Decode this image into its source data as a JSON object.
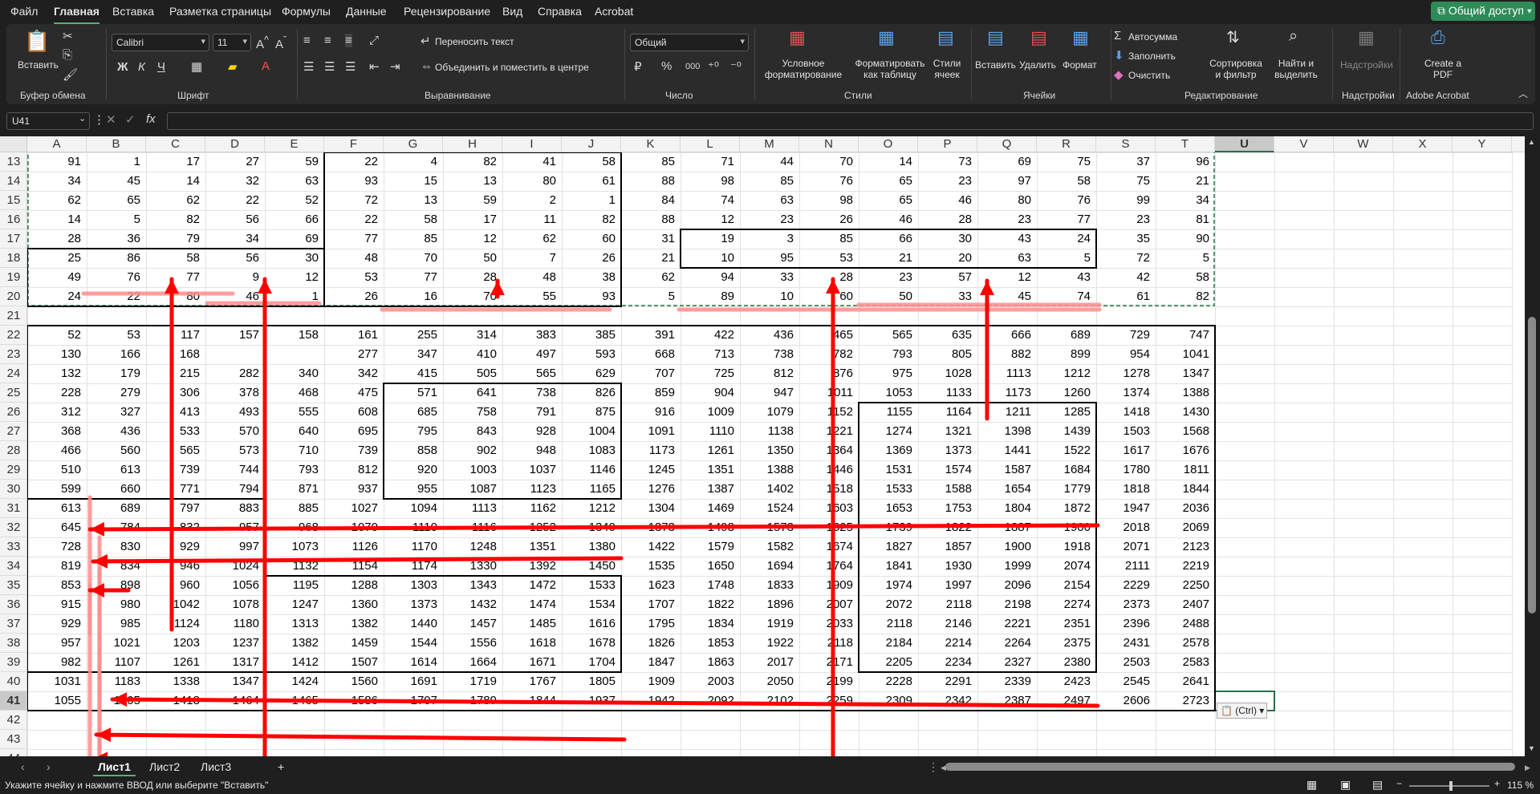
{
  "menu": {
    "items": [
      "Файл",
      "Главная",
      "Вставка",
      "Разметка страницы",
      "Формулы",
      "Данные",
      "Рецензирование",
      "Вид",
      "Справка",
      "Acrobat"
    ],
    "active": "Главная",
    "share": "Общий доступ"
  },
  "ribbon": {
    "clipboard": {
      "paste": "Вставить",
      "group": "Буфер обмена"
    },
    "font": {
      "name": "Calibri",
      "size": "11",
      "group": "Шрифт",
      "bold": "Ж",
      "italic": "К",
      "underline": "Ч"
    },
    "alignment": {
      "wrap": "Переносить текст",
      "merge": "Объединить и поместить в центре",
      "group": "Выравнивание"
    },
    "number": {
      "format": "Общий",
      "percent": "%",
      "thousands": "000",
      "group": "Число"
    },
    "styles": {
      "conditional": "Условное форматирование",
      "as_table": "Форматировать как таблицу",
      "cell_styles": "Стили ячеек",
      "group": "Стили"
    },
    "cells": {
      "insert": "Вставить",
      "delete": "Удалить",
      "format": "Формат",
      "group": "Ячейки"
    },
    "editing": {
      "autosum": "Автосумма",
      "fill": "Заполнить",
      "clear": "Очистить",
      "sort": "Сортировка и фильтр",
      "find": "Найти и выделить",
      "group": "Редактирование"
    },
    "addins": {
      "label": "Надстройки",
      "group": "Надстройки"
    },
    "acrobat": {
      "create": "Create a PDF",
      "group": "Adobe Acrobat"
    }
  },
  "formula_bar": {
    "name_box": "U41",
    "fx": "fx",
    "content": ""
  },
  "columns": [
    "A",
    "B",
    "C",
    "D",
    "E",
    "F",
    "G",
    "H",
    "I",
    "J",
    "K",
    "L",
    "M",
    "N",
    "O",
    "P",
    "Q",
    "R",
    "S",
    "T",
    "U",
    "V",
    "W",
    "X",
    "Y"
  ],
  "selected_column": "U",
  "rows": [
    13,
    14,
    15,
    16,
    17,
    18,
    19,
    20,
    21,
    22,
    23,
    24,
    25,
    26,
    27,
    28,
    29,
    30,
    31,
    32,
    33,
    34,
    35,
    36,
    37,
    38,
    39,
    40,
    41,
    42,
    43,
    44
  ],
  "selected_row": 41,
  "data": [
    [
      "91",
      "1",
      "17",
      "27",
      "59",
      "22",
      "4",
      "82",
      "41",
      "58",
      "85",
      "71",
      "44",
      "70",
      "14",
      "73",
      "69",
      "75",
      "37",
      "96"
    ],
    [
      "34",
      "45",
      "14",
      "32",
      "63",
      "93",
      "15",
      "13",
      "80",
      "61",
      "88",
      "98",
      "85",
      "76",
      "65",
      "23",
      "97",
      "58",
      "75",
      "21"
    ],
    [
      "62",
      "65",
      "62",
      "22",
      "52",
      "72",
      "13",
      "59",
      "2",
      "1",
      "84",
      "74",
      "63",
      "98",
      "65",
      "46",
      "80",
      "76",
      "99",
      "34"
    ],
    [
      "14",
      "5",
      "82",
      "56",
      "66",
      "22",
      "58",
      "17",
      "11",
      "82",
      "88",
      "12",
      "23",
      "26",
      "46",
      "28",
      "23",
      "77",
      "23",
      "81"
    ],
    [
      "28",
      "36",
      "79",
      "34",
      "69",
      "77",
      "85",
      "12",
      "62",
      "60",
      "31",
      "19",
      "3",
      "85",
      "66",
      "30",
      "43",
      "24",
      "35",
      "90"
    ],
    [
      "25",
      "86",
      "58",
      "56",
      "30",
      "48",
      "70",
      "50",
      "7",
      "26",
      "21",
      "10",
      "95",
      "53",
      "21",
      "20",
      "63",
      "5",
      "72",
      "5"
    ],
    [
      "49",
      "76",
      "77",
      "9",
      "12",
      "53",
      "77",
      "28",
      "48",
      "38",
      "62",
      "94",
      "33",
      "28",
      "23",
      "57",
      "12",
      "43",
      "42",
      "58"
    ],
    [
      "24",
      "22",
      "80",
      "46",
      "1",
      "26",
      "16",
      "70",
      "55",
      "93",
      "5",
      "89",
      "10",
      "60",
      "50",
      "33",
      "45",
      "74",
      "61",
      "82"
    ],
    [],
    [
      "52",
      "53",
      "117",
      "157",
      "158",
      "161",
      "255",
      "314",
      "383",
      "385",
      "391",
      "422",
      "436",
      "465",
      "565",
      "635",
      "666",
      "689",
      "729",
      "747"
    ],
    [
      "130",
      "166",
      "168",
      "",
      "",
      "277",
      "347",
      "410",
      "497",
      "593",
      "668",
      "713",
      "738",
      "782",
      "793",
      "805",
      "882",
      "899",
      "954",
      "1041"
    ],
    [
      "132",
      "179",
      "215",
      "282",
      "340",
      "342",
      "415",
      "505",
      "565",
      "629",
      "707",
      "725",
      "812",
      "876",
      "975",
      "1028",
      "1113",
      "1212",
      "1278",
      "1347"
    ],
    [
      "228",
      "279",
      "306",
      "378",
      "468",
      "475",
      "571",
      "641",
      "738",
      "826",
      "859",
      "904",
      "947",
      "1011",
      "1053",
      "1133",
      "1173",
      "1260",
      "1374",
      "1388"
    ],
    [
      "312",
      "327",
      "413",
      "493",
      "555",
      "608",
      "685",
      "758",
      "791",
      "875",
      "916",
      "1009",
      "1079",
      "1152",
      "1155",
      "1164",
      "1211",
      "1285",
      "1418",
      "1430"
    ],
    [
      "368",
      "436",
      "533",
      "570",
      "640",
      "695",
      "795",
      "843",
      "928",
      "1004",
      "1091",
      "1110",
      "1138",
      "1221",
      "1274",
      "1321",
      "1398",
      "1439",
      "1503",
      "1568"
    ],
    [
      "466",
      "560",
      "565",
      "573",
      "710",
      "739",
      "858",
      "902",
      "948",
      "1083",
      "1173",
      "1261",
      "1350",
      "1364",
      "1369",
      "1373",
      "1441",
      "1522",
      "1617",
      "1676"
    ],
    [
      "510",
      "613",
      "739",
      "744",
      "793",
      "812",
      "920",
      "1003",
      "1037",
      "1146",
      "1245",
      "1351",
      "1388",
      "1446",
      "1531",
      "1574",
      "1587",
      "1684",
      "1780",
      "1811"
    ],
    [
      "599",
      "660",
      "771",
      "794",
      "871",
      "937",
      "955",
      "1087",
      "1123",
      "1165",
      "1276",
      "1387",
      "1402",
      "1518",
      "1533",
      "1588",
      "1654",
      "1779",
      "1818",
      "1844"
    ],
    [
      "613",
      "689",
      "797",
      "883",
      "885",
      "1027",
      "1094",
      "1113",
      "1162",
      "1212",
      "1304",
      "1469",
      "1524",
      "1603",
      "1653",
      "1753",
      "1804",
      "1872",
      "1947",
      "2036"
    ],
    [
      "645",
      "784",
      "832",
      "957",
      "968",
      "1070",
      "1110",
      "1116",
      "1252",
      "1340",
      "1373",
      "1498",
      "1573",
      "1625",
      "1739",
      "1822",
      "1887",
      "1900",
      "2018",
      "2069"
    ],
    [
      "728",
      "830",
      "929",
      "997",
      "1073",
      "1126",
      "1170",
      "1248",
      "1351",
      "1380",
      "1422",
      "1579",
      "1582",
      "1674",
      "1827",
      "1857",
      "1900",
      "1918",
      "2071",
      "2123"
    ],
    [
      "819",
      "834",
      "946",
      "1024",
      "1132",
      "1154",
      "1174",
      "1330",
      "1392",
      "1450",
      "1535",
      "1650",
      "1694",
      "1764",
      "1841",
      "1930",
      "1999",
      "2074",
      "2111",
      "2219"
    ],
    [
      "853",
      "898",
      "960",
      "1056",
      "1195",
      "1288",
      "1303",
      "1343",
      "1472",
      "1533",
      "1623",
      "1748",
      "1833",
      "1909",
      "1974",
      "1997",
      "2096",
      "2154",
      "2229",
      "2250"
    ],
    [
      "915",
      "980",
      "1042",
      "1078",
      "1247",
      "1360",
      "1373",
      "1432",
      "1474",
      "1534",
      "1707",
      "1822",
      "1896",
      "2007",
      "2072",
      "2118",
      "2198",
      "2274",
      "2373",
      "2407"
    ],
    [
      "929",
      "985",
      "1124",
      "1180",
      "1313",
      "1382",
      "1440",
      "1457",
      "1485",
      "1616",
      "1795",
      "1834",
      "1919",
      "2033",
      "2118",
      "2146",
      "2221",
      "2351",
      "2396",
      "2488"
    ],
    [
      "957",
      "1021",
      "1203",
      "1237",
      "1382",
      "1459",
      "1544",
      "1556",
      "1618",
      "1678",
      "1826",
      "1853",
      "1922",
      "2118",
      "2184",
      "2214",
      "2264",
      "2375",
      "2431",
      "2578"
    ],
    [
      "982",
      "1107",
      "1261",
      "1317",
      "1412",
      "1507",
      "1614",
      "1664",
      "1671",
      "1704",
      "1847",
      "1863",
      "2017",
      "2171",
      "2205",
      "2234",
      "2327",
      "2380",
      "2503",
      "2583"
    ],
    [
      "1031",
      "1183",
      "1338",
      "1347",
      "1424",
      "1560",
      "1691",
      "1719",
      "1767",
      "1805",
      "1909",
      "2003",
      "2050",
      "2199",
      "2228",
      "2291",
      "2339",
      "2423",
      "2545",
      "2641"
    ],
    [
      "1055",
      "1205",
      "1418",
      "1464",
      "1465",
      "1586",
      "1707",
      "1789",
      "1844",
      "1937",
      "1942",
      "2092",
      "2102",
      "2259",
      "2309",
      "2342",
      "2387",
      "2497",
      "2606",
      "2723"
    ],
    [],
    [],
    []
  ],
  "paste_options": "(Ctrl)",
  "sheets": [
    "Лист1",
    "Лист2",
    "Лист3"
  ],
  "active_sheet": "Лист1",
  "status": {
    "message": "Укажите ячейку и нажмите ВВОД или выберите \"Вставить\"",
    "zoom": "115 %"
  },
  "colors": {
    "accent": "#217346",
    "arrow": "#ff0000",
    "highlight": "#ff8c8c",
    "share": "#2e8b57"
  }
}
